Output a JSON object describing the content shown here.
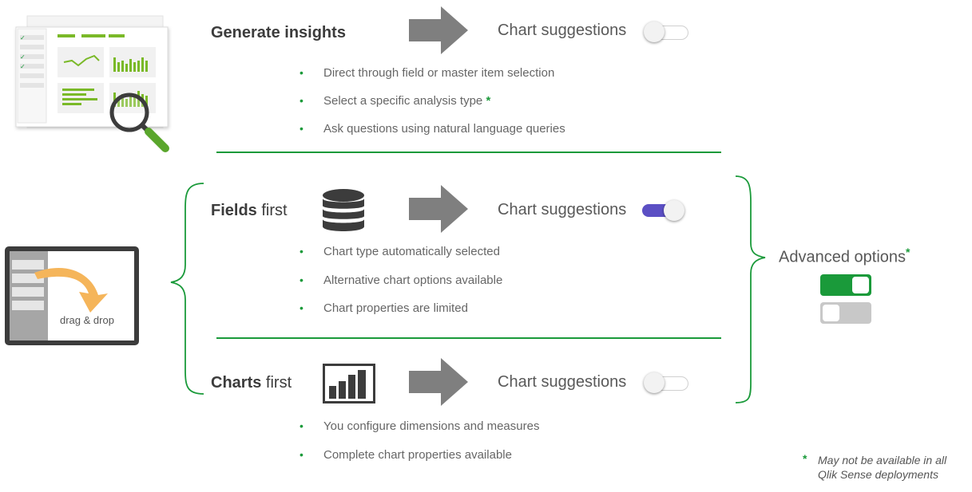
{
  "sections": {
    "insights": {
      "heading_bold": "Generate insights",
      "suggestion_label": "Chart suggestions",
      "toggle_state": "off",
      "bullets": [
        {
          "text": "Direct through field or master item selection",
          "star": ""
        },
        {
          "text": "Select a specific analysis type",
          "star": "*"
        },
        {
          "text": "Ask questions using natural language queries",
          "star": ""
        }
      ]
    },
    "fields": {
      "heading_bold": "Fields",
      "heading_rest": " first",
      "suggestion_label": "Chart suggestions",
      "toggle_state": "on",
      "bullets": [
        {
          "text": "Chart type automatically selected"
        },
        {
          "text": "Alternative chart options available"
        },
        {
          "text": "Chart properties are limited"
        }
      ]
    },
    "charts": {
      "heading_bold": "Charts",
      "heading_rest": " first",
      "suggestion_label": "Chart suggestions",
      "toggle_state": "off",
      "bullets": [
        {
          "text": "You configure dimensions and measures"
        },
        {
          "text": "Complete chart properties available"
        }
      ]
    }
  },
  "bullet_symbol": "•",
  "drag_drop_label": "drag & drop",
  "advanced": {
    "label": "Advanced options",
    "star": "*",
    "toggles": [
      "on",
      "off"
    ]
  },
  "footnote": {
    "star": "*",
    "line1": "May not be available in all",
    "line2": "Qlik Sense deployments"
  },
  "colors": {
    "green": "#1a9a3a",
    "toggle_on_purple": "#5b4fc4",
    "arrow_gray": "#7f7f7f",
    "orange_arrow": "#f5b55a"
  },
  "icons": [
    "dashboard-magnifier-icon",
    "database-icon",
    "bar-chart-icon",
    "arrow-right-icon",
    "drag-drop-tablet-icon"
  ]
}
